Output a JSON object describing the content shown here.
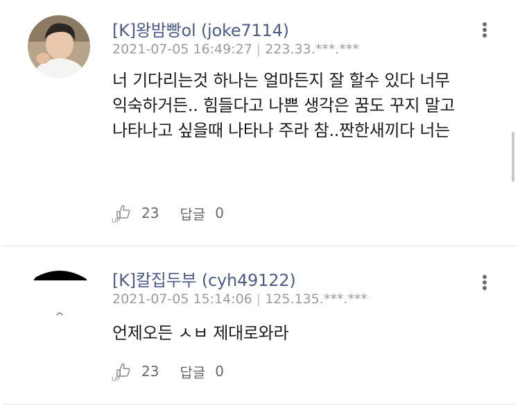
{
  "comments": [
    {
      "author": "[K]왕밤빵ol (joke7114)",
      "date": "2021-07-05 16:49:27",
      "ip": "223.33.***.***",
      "text": "너 기다리는것 하나는 얼마든지 잘 할수 있다 너무\n익숙하거든.. 힘들다고 나쁜 생각은 꿈도 꾸지 말고\n나타나고 싶을때 나타나 주라 참..짠한새끼다 너는",
      "up_count": "23",
      "reply_label": "답글",
      "reply_count": "0"
    },
    {
      "author": "[K]칼집두부 (cyh49122)",
      "date": "2021-07-05 15:14:06",
      "ip": "125.135.***.***",
      "text": "언제오든 ㅅㅂ 제대로와라",
      "up_count": "23",
      "reply_label": "답글",
      "reply_count": "0"
    }
  ],
  "icons": {
    "more": "kebab-menu-icon",
    "up": "thumbs-up-icon"
  },
  "colors": {
    "author": "#4a5a8c",
    "meta": "#9a9a9a",
    "divider": "#e6e6e6"
  }
}
